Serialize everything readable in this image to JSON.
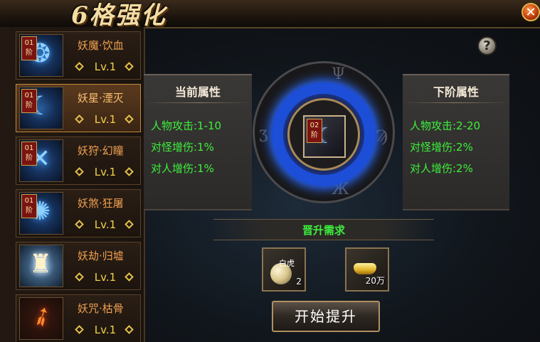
{
  "window": {
    "title": "6格强化",
    "close_icon": "close-icon"
  },
  "sidebar": {
    "items": [
      {
        "badge": "01阶",
        "name": "妖魔·饮血",
        "level": "Lv.1",
        "icon": "blue-flame-emblem-icon",
        "selected": false
      },
      {
        "badge": "01阶",
        "name": "妖星·湮灭",
        "level": "Lv.1",
        "icon": "blue-crescent-emblem-icon",
        "selected": true
      },
      {
        "badge": "01阶",
        "name": "妖狩·幻瞳",
        "level": "Lv.1",
        "icon": "blue-crossed-blades-emblem-icon",
        "selected": false
      },
      {
        "badge": "01阶",
        "name": "妖煞·狂屠",
        "level": "Lv.1",
        "icon": "blue-beast-emblem-icon",
        "selected": false
      },
      {
        "badge": "",
        "name": "妖劫·归墟",
        "level": "Lv.1",
        "icon": "white-armor-figure-icon",
        "selected": false
      },
      {
        "badge": "",
        "name": "妖咒·枯骨",
        "level": "Lv.1",
        "icon": "fire-feather-icon",
        "selected": false
      }
    ]
  },
  "current_attrs": {
    "title": "当前属性",
    "lines": [
      "人物攻击:1-10",
      "对怪增伤:1%",
      "对人增伤:1%"
    ]
  },
  "next_attrs": {
    "title": "下阶属性",
    "lines": [
      "人物攻击:2-20",
      "对怪增伤:2%",
      "对人增伤:2%"
    ]
  },
  "center_item": {
    "badge": "02阶",
    "icon": "blue-crescent-emblem-icon"
  },
  "requirements": {
    "title": "晋升需求",
    "materials": [
      {
        "label": "白虎",
        "qty": "2",
        "icon": "moon-orb-icon"
      },
      {
        "label": "",
        "qty": "20万",
        "icon": "gold-ingot-icon"
      }
    ]
  },
  "start_button": "开始提升",
  "help_icon": "question-icon",
  "colors": {
    "attr_green": "#3cf03c",
    "level_gold": "#f2d24a",
    "name_orange": "#f0a050",
    "wheel_blue": "#1c4ed8",
    "badge_red": "#7a1410"
  }
}
